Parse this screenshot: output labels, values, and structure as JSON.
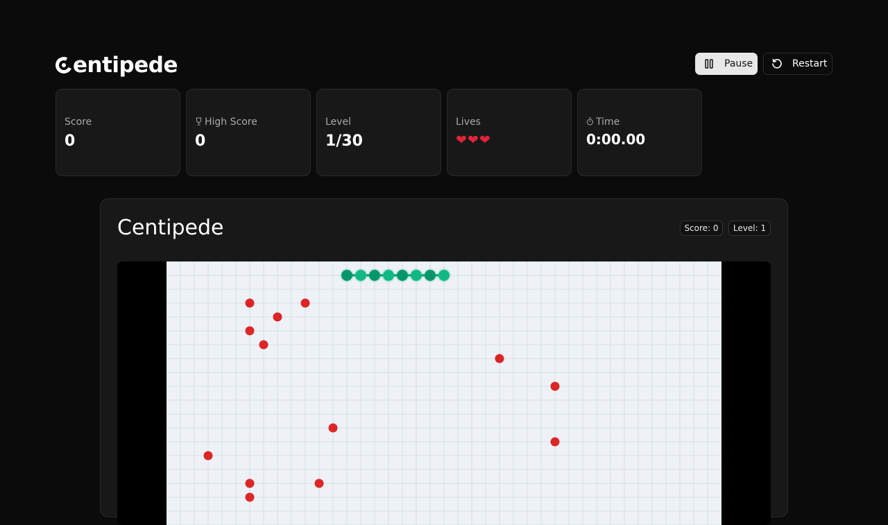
{
  "header": {
    "logo_text": "entipede",
    "pause_label": "Pause",
    "restart_label": "Restart"
  },
  "stats": {
    "score_label": "Score",
    "score_value": "0",
    "high_score_label": "High Score",
    "high_score_value": "0",
    "level_label": "Level",
    "level_value": "1/30",
    "lives_label": "Lives",
    "lives_value": "❤❤❤",
    "time_label": "Time",
    "time_value": "0:00.00"
  },
  "game_panel": {
    "title": "Centipede",
    "score_badge": "Score: 0",
    "level_badge": "Level: 1"
  },
  "board": {
    "background_color": "#eef2f7",
    "grid_color": "#d7dde6",
    "mushroom_color": "#dc2626",
    "centipede_colors": [
      "#059669",
      "#10b981"
    ],
    "centipede": [
      {
        "col": 13,
        "row": 1
      },
      {
        "col": 14,
        "row": 1
      },
      {
        "col": 15,
        "row": 1
      },
      {
        "col": 16,
        "row": 1
      },
      {
        "col": 17,
        "row": 1
      },
      {
        "col": 18,
        "row": 1
      },
      {
        "col": 19,
        "row": 1
      },
      {
        "col": 20,
        "row": 1
      }
    ],
    "mushrooms": [
      {
        "col": 6,
        "row": 3
      },
      {
        "col": 10,
        "row": 3
      },
      {
        "col": 8,
        "row": 4
      },
      {
        "col": 6,
        "row": 5
      },
      {
        "col": 7,
        "row": 6
      },
      {
        "col": 24,
        "row": 7
      },
      {
        "col": 28,
        "row": 9
      },
      {
        "col": 12,
        "row": 12
      },
      {
        "col": 28,
        "row": 13
      },
      {
        "col": 3,
        "row": 14
      },
      {
        "col": 6,
        "row": 16
      },
      {
        "col": 11,
        "row": 16
      },
      {
        "col": 6,
        "row": 17
      }
    ]
  }
}
